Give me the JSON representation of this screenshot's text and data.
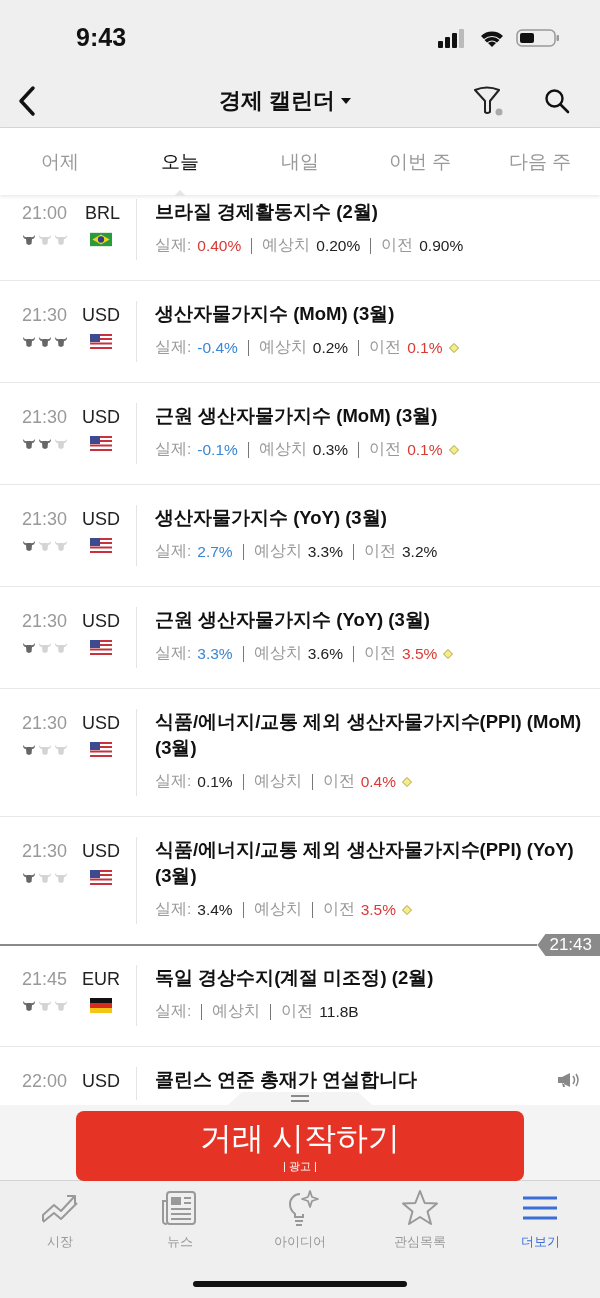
{
  "status_bar": {
    "time": "9:43"
  },
  "header": {
    "title": "경제 캘린더"
  },
  "tabs": [
    {
      "label": "어제",
      "selected": false
    },
    {
      "label": "오늘",
      "selected": true
    },
    {
      "label": "내일",
      "selected": false
    },
    {
      "label": "이번 주",
      "selected": false
    },
    {
      "label": "다음 주",
      "selected": false
    }
  ],
  "rows": [
    {
      "time": "21:00",
      "currency": "BRL",
      "flag": {
        "kind": "br"
      },
      "stars": 1,
      "title": "브라질 경제활동지수 (2월)",
      "actual_label": "실제:",
      "actual": {
        "text": "0.40%",
        "color": "#d83a34"
      },
      "forecast_label": "예상치",
      "forecast": "0.20%",
      "previous_label": "이전",
      "previous": "0.90%",
      "previous_revised": false
    },
    {
      "time": "21:30",
      "currency": "USD",
      "flag": {
        "kind": "us"
      },
      "stars": 3,
      "title": "생산자물가지수 (MoM) (3월)",
      "actual_label": "실제:",
      "actual": {
        "text": "-0.4%",
        "color": "#3a86d2"
      },
      "forecast_label": "예상치",
      "forecast": "0.2%",
      "previous_label": "이전",
      "previous": "0.1%",
      "previous_revised": true
    },
    {
      "time": "21:30",
      "currency": "USD",
      "flag": {
        "kind": "us"
      },
      "stars": 2,
      "title": "근원 생산자물가지수 (MoM) (3월)",
      "actual_label": "실제:",
      "actual": {
        "text": "-0.1%",
        "color": "#3a86d2"
      },
      "forecast_label": "예상치",
      "forecast": "0.3%",
      "previous_label": "이전",
      "previous": "0.1%",
      "previous_revised": true
    },
    {
      "time": "21:30",
      "currency": "USD",
      "flag": {
        "kind": "us"
      },
      "stars": 1,
      "title": "생산자물가지수 (YoY) (3월)",
      "actual_label": "실제:",
      "actual": {
        "text": "2.7%",
        "color": "#3a86d2"
      },
      "forecast_label": "예상치",
      "forecast": "3.3%",
      "previous_label": "이전",
      "previous": "3.2%",
      "previous_revised": false
    },
    {
      "time": "21:30",
      "currency": "USD",
      "flag": {
        "kind": "us"
      },
      "stars": 1,
      "title": "근원 생산자물가지수 (YoY) (3월)",
      "actual_label": "실제:",
      "actual": {
        "text": "3.3%",
        "color": "#3a86d2"
      },
      "forecast_label": "예상치",
      "forecast": "3.6%",
      "previous_label": "이전",
      "previous": "3.5%",
      "previous_revised": true
    },
    {
      "time": "21:30",
      "currency": "USD",
      "flag": {
        "kind": "us"
      },
      "stars": 1,
      "title": "식품/에너지/교통 제외 생산자물가지수(PPI) (MoM) (3월)",
      "actual_label": "실제:",
      "actual": {
        "text": "0.1%",
        "color": "#222222"
      },
      "forecast_label": "예상치",
      "previous_label": "이전",
      "previous": "0.4%",
      "previous_revised": true
    },
    {
      "time": "21:30",
      "currency": "USD",
      "flag": {
        "kind": "us"
      },
      "stars": 1,
      "title": "식품/에너지/교통 제외 생산자물가지수(PPI) (YoY) (3월)",
      "actual_label": "실제:",
      "actual": {
        "text": "3.4%",
        "color": "#222222"
      },
      "forecast_label": "예상치",
      "previous_label": "이전",
      "previous": "3.5%",
      "previous_revised": true
    },
    {
      "kind": "now",
      "time": "21:43"
    },
    {
      "time": "21:45",
      "currency": "EUR",
      "flag": {
        "kind": "de"
      },
      "stars": 1,
      "title": "독일 경상수지(계절 미조정) (2월)",
      "actual_label": "실제:",
      "forecast_label": "예상치",
      "previous_label": "이전",
      "previous": "11.8B",
      "previous_revised": false
    },
    {
      "kind": "speech",
      "time": "22:00",
      "currency": "USD",
      "title": "콜린스 연준 총재가 연설합니다"
    }
  ],
  "ad": {
    "button": "거래 시작하기",
    "label": "| 광고 |"
  },
  "bottom_nav": [
    {
      "label": "시장",
      "kind": "chart",
      "selected": false
    },
    {
      "label": "뉴스",
      "kind": "news",
      "selected": false
    },
    {
      "label": "아이디어",
      "kind": "idea",
      "selected": false
    },
    {
      "label": "관심목록",
      "kind": "star",
      "selected": false
    },
    {
      "label": "더보기",
      "kind": "menu",
      "selected": true
    }
  ]
}
